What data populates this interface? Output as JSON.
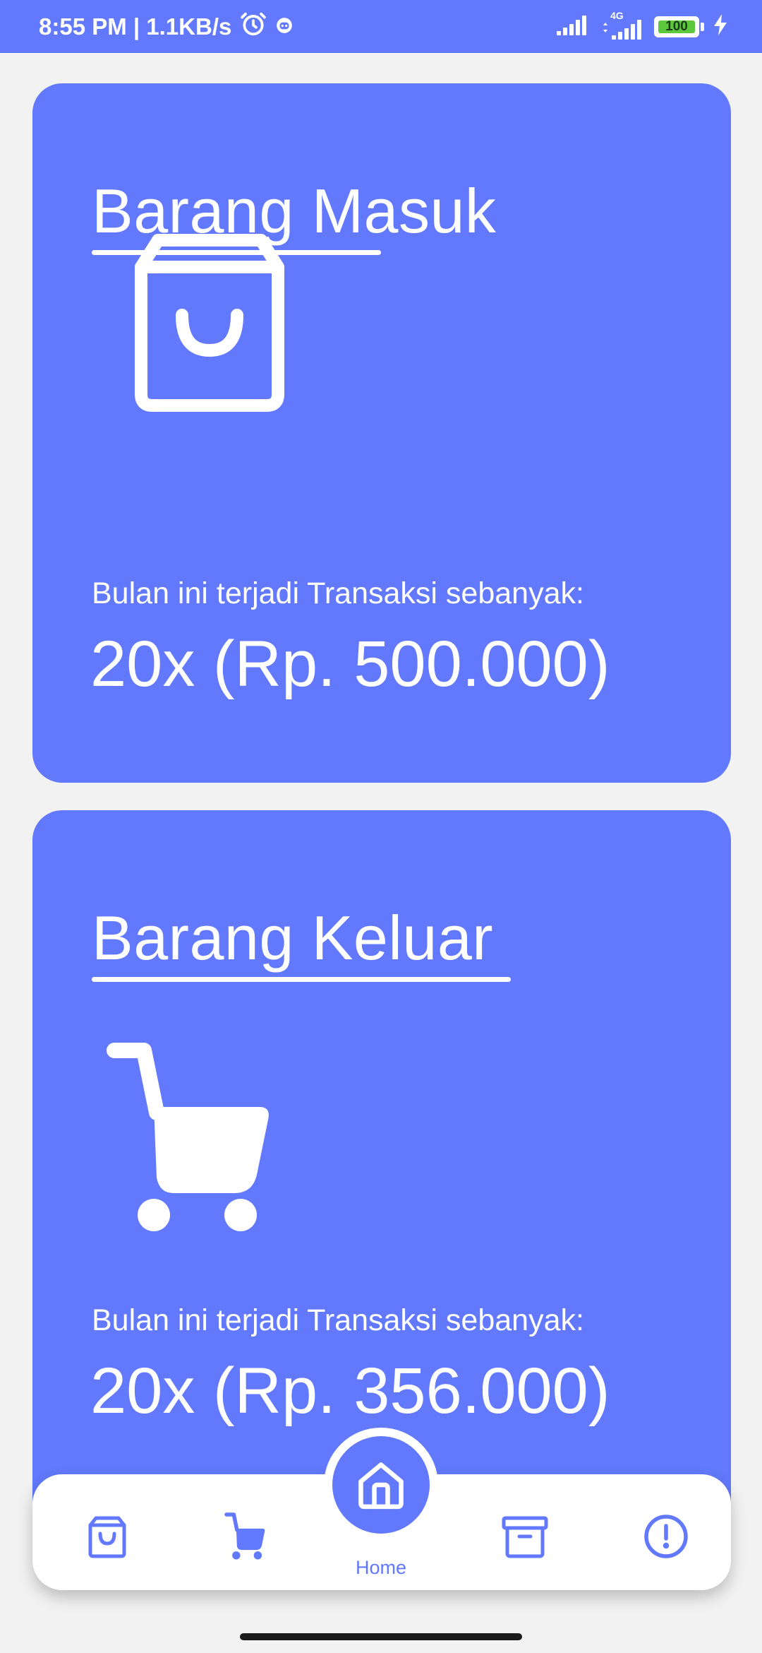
{
  "status_bar": {
    "time_speed": "8:55 PM | 1.1KB/s",
    "network_label": "4G",
    "battery_level": "100",
    "icons": [
      "alarm-icon",
      "notification-icon",
      "signal-icon",
      "signal-4g-icon",
      "battery-icon",
      "charging-icon"
    ]
  },
  "cards": [
    {
      "title": "Barang Masuk",
      "icon": "shopping-bag-icon",
      "caption": "Bulan ini terjadi Transaksi sebanyak:",
      "value": "20x (Rp. 500.000)"
    },
    {
      "title": "Barang Keluar",
      "icon": "shopping-cart-icon",
      "caption": "Bulan ini terjadi Transaksi sebanyak:",
      "value": "20x (Rp. 356.000)"
    }
  ],
  "bottom_nav": {
    "items": [
      {
        "icon": "shopping-bag-icon",
        "active": false
      },
      {
        "icon": "shopping-cart-icon",
        "active": false
      },
      {
        "icon": "home-icon",
        "label": "Home",
        "active": true
      },
      {
        "icon": "archive-icon",
        "active": false
      },
      {
        "icon": "alert-circle-icon",
        "active": false
      }
    ]
  },
  "colors": {
    "accent": "#6279fd",
    "background": "#f2f2f2",
    "card_text": "#ffffff",
    "battery_green": "#5ec83c"
  }
}
